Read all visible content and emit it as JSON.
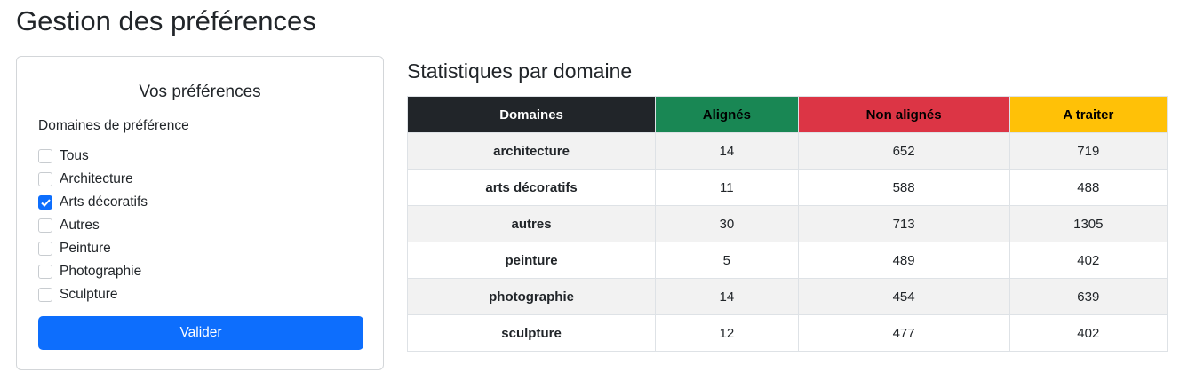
{
  "page": {
    "title": "Gestion des préférences"
  },
  "preferences": {
    "card_title": "Vos préférences",
    "group_label": "Domaines de préférence",
    "options": [
      {
        "label": "Tous",
        "checked": false
      },
      {
        "label": "Architecture",
        "checked": false
      },
      {
        "label": "Arts décoratifs",
        "checked": true
      },
      {
        "label": "Autres",
        "checked": false
      },
      {
        "label": "Peinture",
        "checked": false
      },
      {
        "label": "Photographie",
        "checked": false
      },
      {
        "label": "Sculpture",
        "checked": false
      }
    ],
    "submit_label": "Valider"
  },
  "stats": {
    "title": "Statistiques par domaine",
    "headers": [
      "Domaines",
      "Alignés",
      "Non alignés",
      "A traiter"
    ],
    "rows": [
      [
        "architecture",
        "14",
        "652",
        "719"
      ],
      [
        "arts décoratifs",
        "11",
        "588",
        "488"
      ],
      [
        "autres",
        "30",
        "713",
        "1305"
      ],
      [
        "peinture",
        "5",
        "489",
        "402"
      ],
      [
        "photographie",
        "14",
        "454",
        "639"
      ],
      [
        "sculpture",
        "12",
        "477",
        "402"
      ]
    ]
  },
  "colors": {
    "primary": "#0d6efd",
    "header_domain": "#212529",
    "header_aligned": "#198754",
    "header_unaligned": "#dc3545",
    "header_todo": "#ffc107"
  }
}
